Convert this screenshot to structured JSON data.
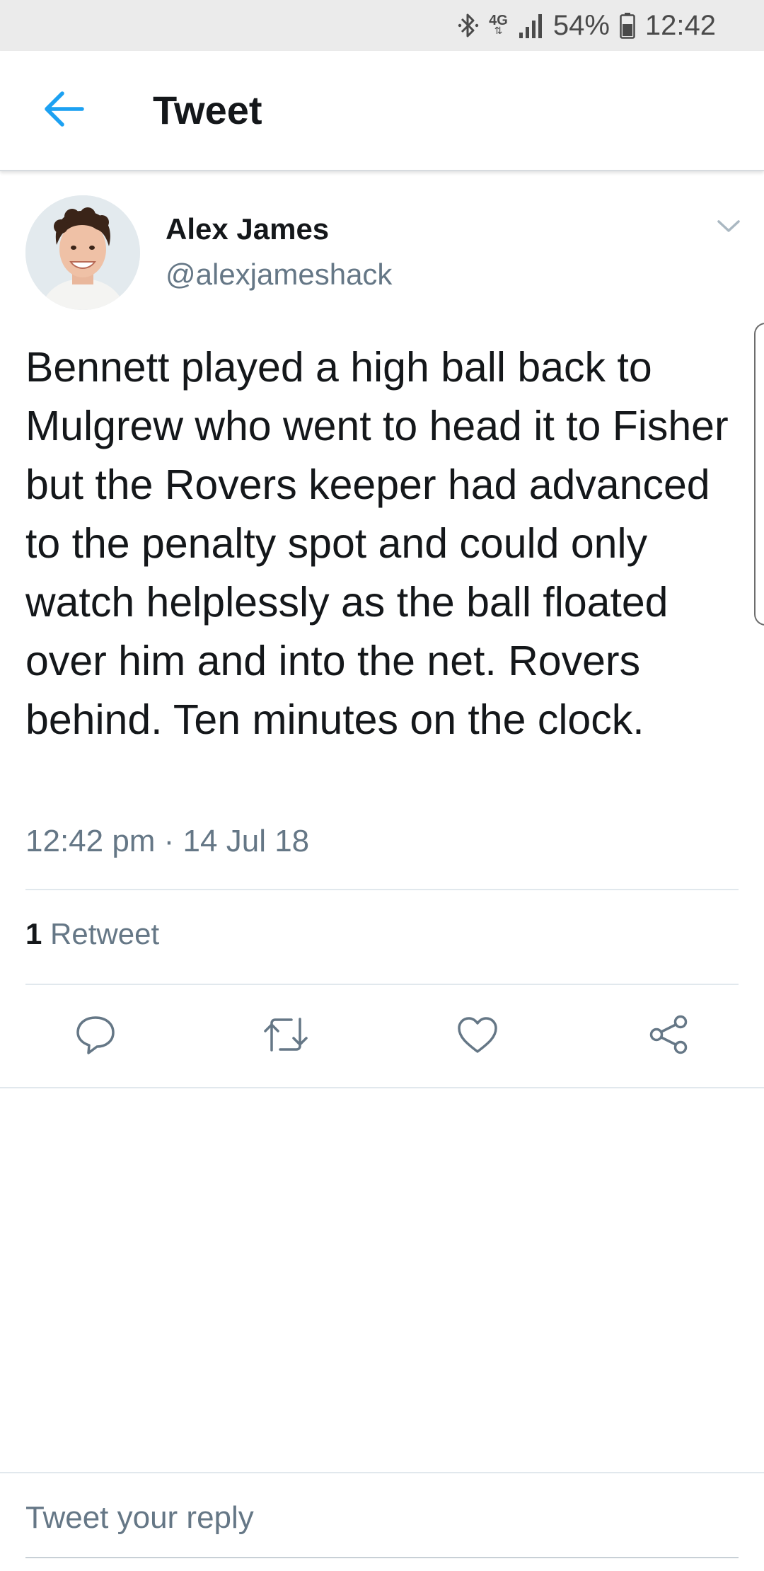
{
  "status_bar": {
    "network": "4G",
    "battery": "54%",
    "time": "12:42",
    "icons": [
      "bluetooth-icon",
      "network-4g-icon",
      "signal-icon",
      "battery-icon"
    ]
  },
  "app_bar": {
    "title": "Tweet",
    "back_icon": "back-arrow-icon"
  },
  "tweet": {
    "author_name": "Alex James",
    "author_handle": "@alexjameshack",
    "text": "Bennett played a high ball back to Mulgrew who went to head it to Fisher but the Rovers keeper had advanced to the penalty spot and could only watch helplessly as the ball floated over him and into the net. Rovers behind. Ten minutes on the clock.",
    "timestamp": "12:42 pm · 14 Jul 18",
    "retweet_count": "1",
    "retweet_label": "Retweet"
  },
  "actions": [
    {
      "name": "reply",
      "icon": "reply-icon"
    },
    {
      "name": "retweet",
      "icon": "retweet-icon"
    },
    {
      "name": "like",
      "icon": "heart-icon"
    },
    {
      "name": "share",
      "icon": "share-icon"
    }
  ],
  "reply_box": {
    "placeholder": "Tweet your reply"
  },
  "colors": {
    "accent": "#1da1f2",
    "text_primary": "#14171a",
    "text_secondary": "#657786",
    "divider": "#e1e8ed",
    "status_bar_bg": "#ebebeb"
  }
}
